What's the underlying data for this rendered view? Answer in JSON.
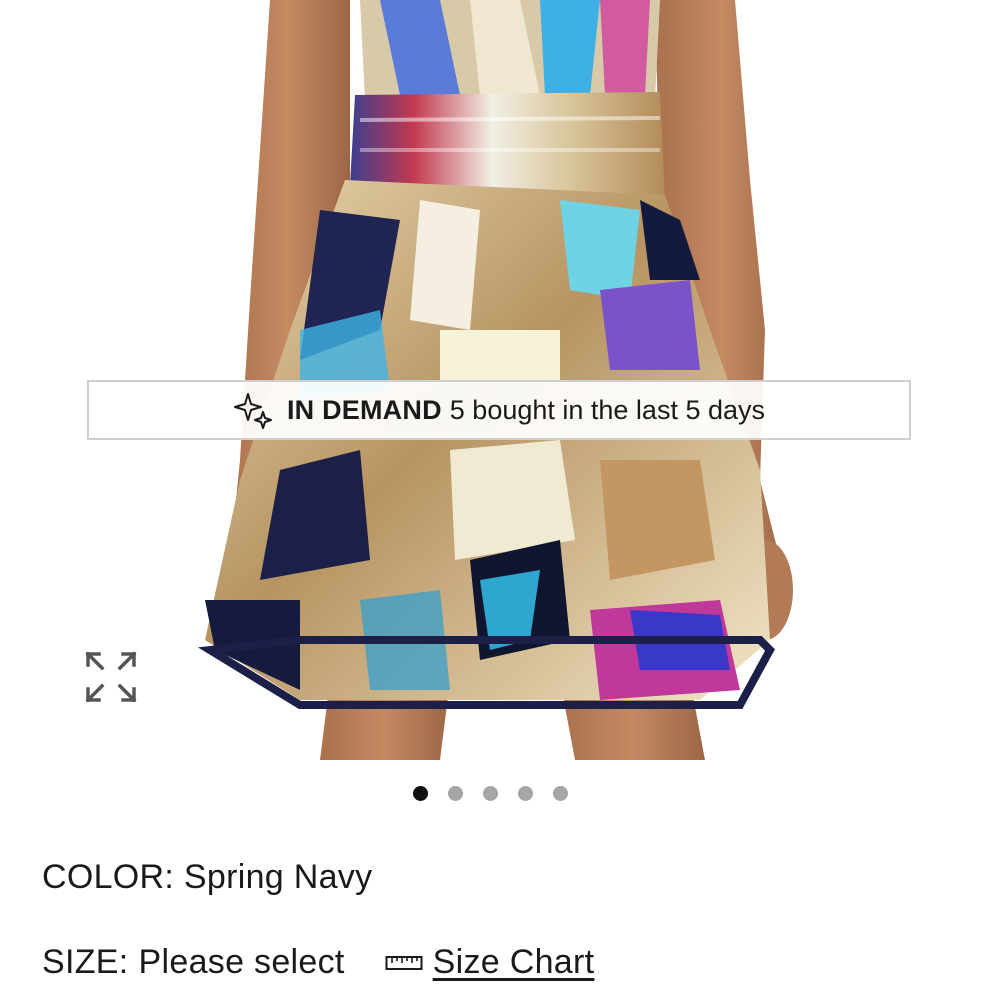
{
  "banner": {
    "strong": "IN DEMAND",
    "text": "5 bought in the last 5 days",
    "icon": "sparkle-icon"
  },
  "gallery": {
    "image_count": 5,
    "active_index": 0,
    "expand_icon": "expand-icon"
  },
  "product": {
    "color_label": "COLOR:",
    "color_value": "Spring Navy",
    "size_label": "SIZE:",
    "size_value": "Please select",
    "size_chart_label": "Size Chart",
    "size_chart_icon": "ruler-icon"
  },
  "colors": {
    "dot_active": "#111111",
    "dot_inactive": "#a6a6a6",
    "banner_border": "#cfcfcf"
  }
}
